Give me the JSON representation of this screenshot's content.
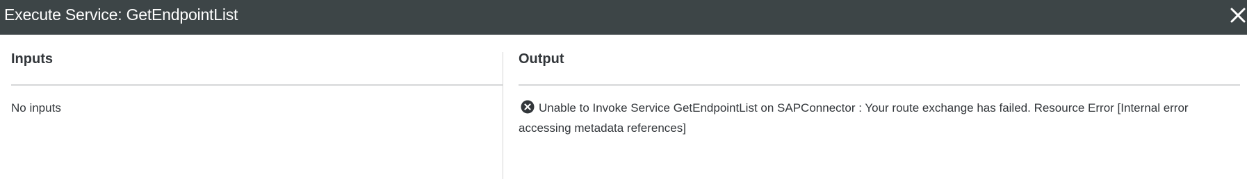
{
  "dialog": {
    "title": "Execute Service: GetEndpointList",
    "close_icon": "close-icon"
  },
  "inputs": {
    "heading": "Inputs",
    "message": "No inputs"
  },
  "output": {
    "heading": "Output",
    "status_icon": "error-circle-icon",
    "message": "Unable to Invoke Service GetEndpointList on SAPConnector : Your route exchange has failed. Resource Error [Internal error accessing metadata references]"
  },
  "colors": {
    "titlebar_bg": "#3d4547",
    "text": "#32363a"
  }
}
